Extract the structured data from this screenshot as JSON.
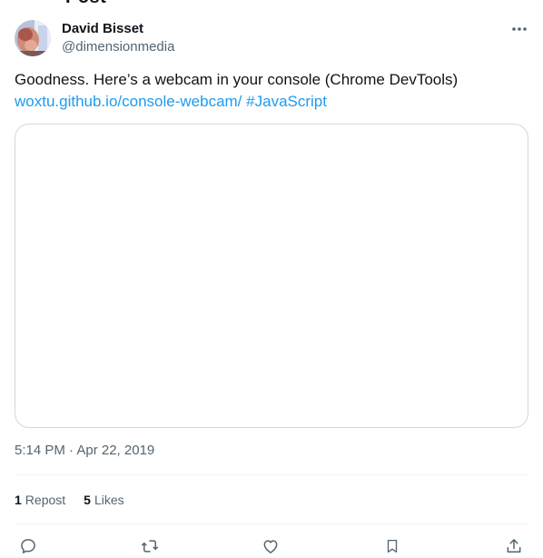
{
  "header": {
    "title": "Post"
  },
  "author": {
    "name": "David Bisset",
    "handle": "@dimensionmedia"
  },
  "tweet": {
    "text": "Goodness. Here’s a webcam in your console (Chrome DevTools)",
    "link": "woxtu.github.io/console-webcam/",
    "hashtag": "#JavaScript"
  },
  "meta": {
    "timestamp": "5:14 PM · Apr 22, 2019"
  },
  "stats": {
    "reposts_count": "1",
    "reposts_label": "Repost",
    "likes_count": "5",
    "likes_label": "Likes"
  },
  "icons": {
    "more": "more-horizontal-icon",
    "reply": "reply-icon",
    "repost": "repost-icon",
    "like": "like-icon",
    "bookmark": "bookmark-icon",
    "share": "share-icon"
  },
  "colors": {
    "text": "#0f1419",
    "secondary": "#536471",
    "link": "#1d9bf0",
    "border": "#cfd9de",
    "divider": "#eff3f4"
  }
}
